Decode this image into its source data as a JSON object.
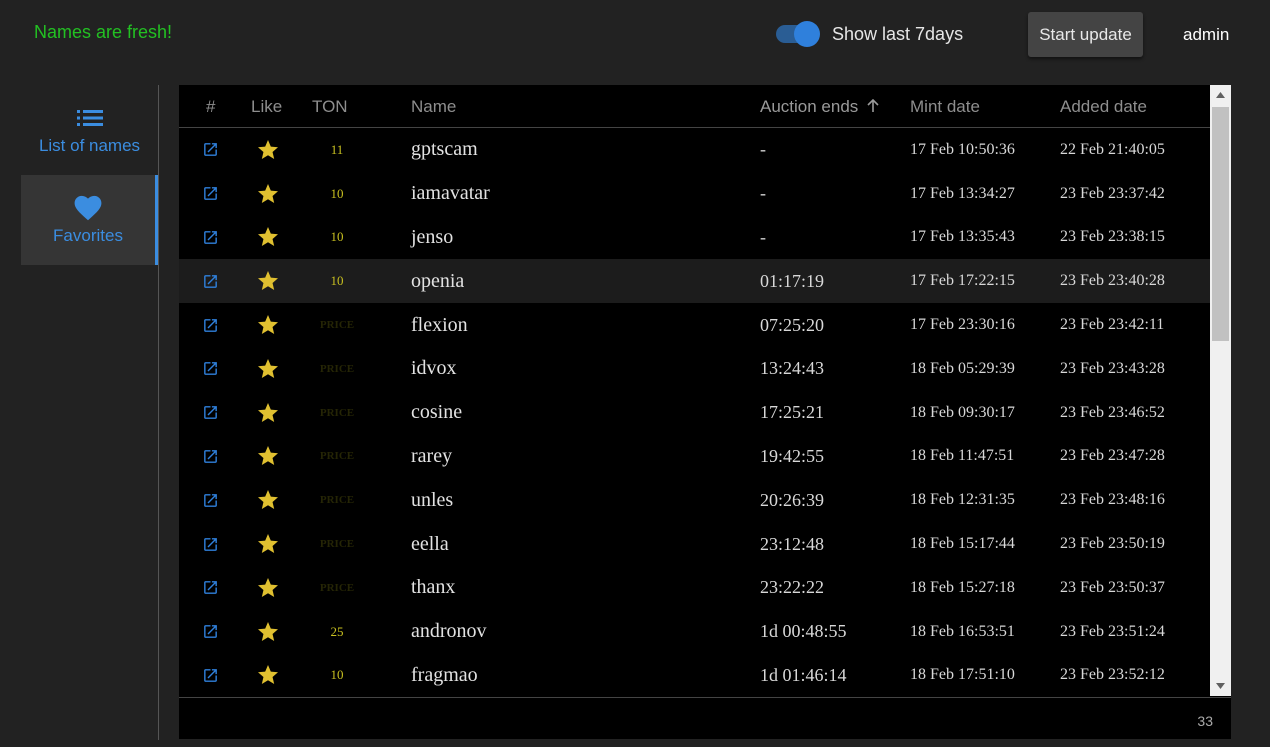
{
  "header": {
    "status_text": "Names are fresh!",
    "toggle_label": "Show last 7days",
    "toggle_on": true,
    "update_button": "Start update",
    "user": "admin"
  },
  "sidebar": {
    "items": [
      {
        "label": "List of names",
        "icon": "list-icon",
        "active": false
      },
      {
        "label": "Favorites",
        "icon": "heart-icon",
        "active": true
      }
    ]
  },
  "table": {
    "columns": [
      "#",
      "Like",
      "TON",
      "Name",
      "Auction ends",
      "Mint date",
      "Added date"
    ],
    "sort_column": "Auction ends",
    "sort_direction": "ascending",
    "rows": [
      {
        "ton": "11",
        "name": "gptscam",
        "auction": "-",
        "mint": "17 Feb 10:50:36",
        "added": "22 Feb 21:40:05"
      },
      {
        "ton": "10",
        "name": "iamavatar",
        "auction": "-",
        "mint": "17 Feb 13:34:27",
        "added": "23 Feb 23:37:42"
      },
      {
        "ton": "10",
        "name": "jenso",
        "auction": "-",
        "mint": "17 Feb 13:35:43",
        "added": "23 Feb 23:38:15"
      },
      {
        "ton": "10",
        "name": "openia",
        "auction": "01:17:19",
        "mint": "17 Feb 17:22:15",
        "added": "23 Feb 23:40:28"
      },
      {
        "ton": "PRICE",
        "name": "flexion",
        "auction": "07:25:20",
        "mint": "17 Feb 23:30:16",
        "added": "23 Feb 23:42:11"
      },
      {
        "ton": "PRICE",
        "name": "idvox",
        "auction": "13:24:43",
        "mint": "18 Feb 05:29:39",
        "added": "23 Feb 23:43:28"
      },
      {
        "ton": "PRICE",
        "name": "cosine",
        "auction": "17:25:21",
        "mint": "18 Feb 09:30:17",
        "added": "23 Feb 23:46:52"
      },
      {
        "ton": "PRICE",
        "name": "rarey",
        "auction": "19:42:55",
        "mint": "18 Feb 11:47:51",
        "added": "23 Feb 23:47:28"
      },
      {
        "ton": "PRICE",
        "name": "unles",
        "auction": "20:26:39",
        "mint": "18 Feb 12:31:35",
        "added": "23 Feb 23:48:16"
      },
      {
        "ton": "PRICE",
        "name": "eella",
        "auction": "23:12:48",
        "mint": "18 Feb 15:17:44",
        "added": "23 Feb 23:50:19"
      },
      {
        "ton": "PRICE",
        "name": "thanx",
        "auction": "23:22:22",
        "mint": "18 Feb 15:27:18",
        "added": "23 Feb 23:50:37"
      },
      {
        "ton": "25",
        "name": "andronov",
        "auction": "1d 00:48:55",
        "mint": "18 Feb 16:53:51",
        "added": "23 Feb 23:51:24"
      },
      {
        "ton": "10",
        "name": "fragmao",
        "auction": "1d 01:46:14",
        "mint": "18 Feb 17:51:10",
        "added": "23 Feb 23:52:12"
      }
    ],
    "total_count": "33"
  },
  "colors": {
    "accent": "#3b8de0",
    "status_green": "#22c022",
    "star": "#e0c030",
    "ton": "#c8c020"
  }
}
